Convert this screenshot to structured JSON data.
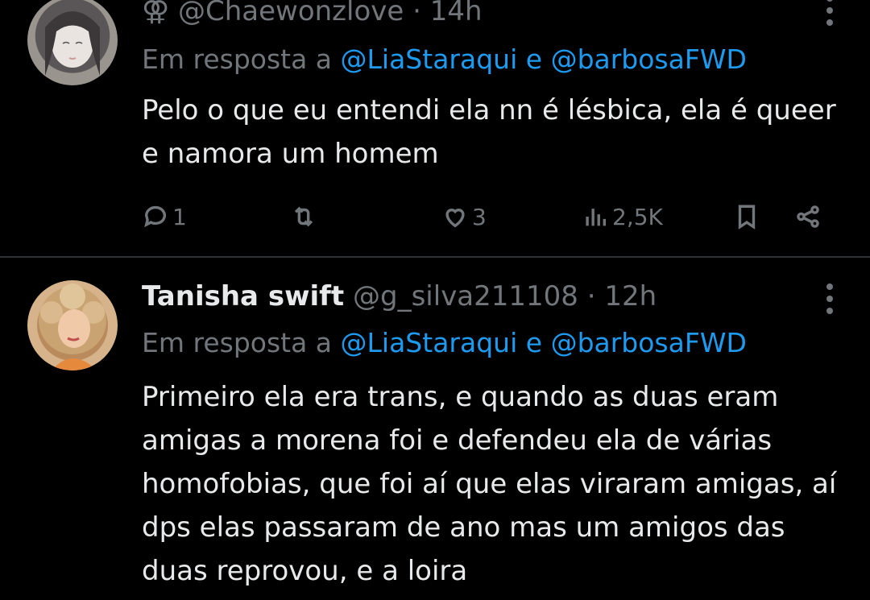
{
  "tweets": [
    {
      "name": "",
      "handle_prefix": "⚢",
      "handle": "@Chaewonzlove",
      "separator": "·",
      "time": "14h",
      "reply_prefix": "Em resposta a",
      "reply_mention_1": "@LiaStaraqui",
      "reply_conj": "e",
      "reply_mention_2": "@barbosaFWD",
      "text": "Pelo o que eu entendi ela nn é lésbica, ela é queer e namora um homem",
      "replies": "1",
      "retweets": "",
      "likes": "3",
      "views": "2,5K"
    },
    {
      "name": "Tanisha swift",
      "handle": "@g_silva211108",
      "separator": "·",
      "time": "12h",
      "reply_prefix": "Em resposta a",
      "reply_mention_1": "@LiaStaraqui",
      "reply_conj": "e",
      "reply_mention_2": "@barbosaFWD",
      "text": "Primeiro ela era trans, e quando as duas eram amigas a morena foi e defendeu ela de várias homofobias, que foi aí que elas viraram amigas, aí dps elas passaram de ano mas um amigos das duas reprovou, e a loira"
    }
  ],
  "colors": {
    "background": "#000000",
    "text": "#e7e9ea",
    "muted": "#71767b",
    "link": "#1d9bf0"
  },
  "icons": [
    "reply-icon",
    "retweet-icon",
    "like-icon",
    "views-icon",
    "bookmark-icon",
    "share-icon",
    "more-icon"
  ]
}
